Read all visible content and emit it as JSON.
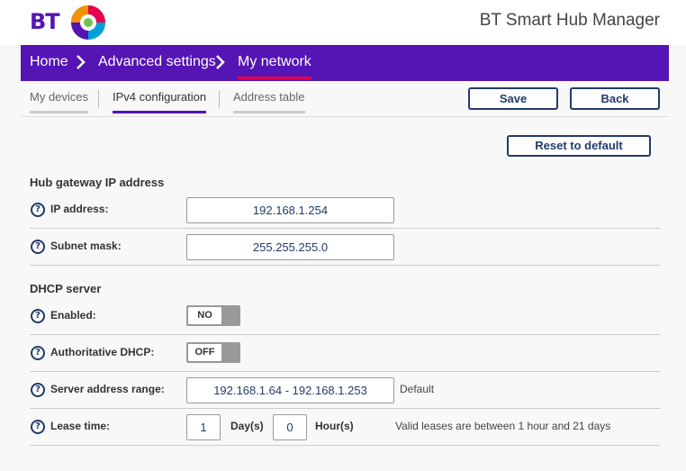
{
  "brand": {
    "logo_text": "BT",
    "app_title": "BT Smart Hub Manager",
    "colors": {
      "primary": "#5514b4",
      "accent": "#e60050",
      "button": "#223b6a"
    }
  },
  "nav": {
    "items": [
      {
        "label": "Home"
      },
      {
        "label": "Advanced settings"
      },
      {
        "label": "My network"
      }
    ]
  },
  "tabs": [
    {
      "label": "My devices"
    },
    {
      "label": "IPv4 configuration"
    },
    {
      "label": "Address table"
    }
  ],
  "actions": {
    "save_label": "Save",
    "back_label": "Back",
    "reset_label": "Reset to default"
  },
  "gateway": {
    "title": "Hub gateway IP address",
    "ip_label": "IP address:",
    "ip_value": "192.168.1.254",
    "subnet_label": "Subnet mask:",
    "subnet_value": "255.255.255.0"
  },
  "dhcp": {
    "title": "DHCP server",
    "enabled_label": "Enabled:",
    "enabled_value": "NO",
    "auth_label": "Authoritative DHCP:",
    "auth_value": "OFF",
    "range_label": "Server address range:",
    "range_value": "192.168.1.64 - 192.168.1.253",
    "range_note": "Default",
    "lease_label": "Lease time:",
    "lease_days": "1",
    "days_unit": "Day(s)",
    "lease_hours": "0",
    "hours_unit": "Hour(s)",
    "lease_note": "Valid leases are between 1 hour and 21 days"
  },
  "help_glyph": "?"
}
